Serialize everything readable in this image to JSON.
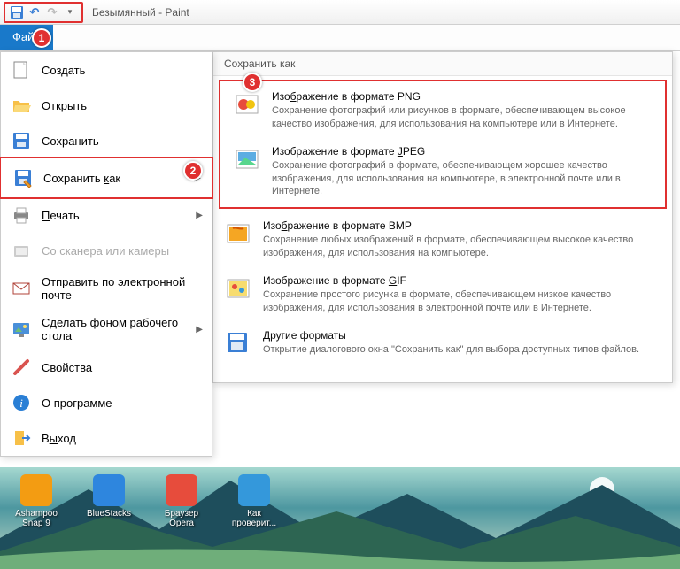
{
  "window": {
    "title": "Безымянный - Paint"
  },
  "tabs": {
    "file": "Файл"
  },
  "markers": {
    "m1": "1",
    "m2": "2",
    "m3": "3"
  },
  "file_menu": [
    {
      "label": "Создать",
      "icon": "new"
    },
    {
      "label": "Открыть",
      "icon": "open"
    },
    {
      "label": "Сохранить",
      "icon": "save"
    },
    {
      "label": "Сохранить как",
      "icon": "saveas",
      "arrow": true,
      "highlighted": true,
      "accel": "к"
    },
    {
      "label": "Печать",
      "icon": "print",
      "arrow": true,
      "accel": "П"
    },
    {
      "label": "Со сканера или камеры",
      "icon": "scanner",
      "disabled": true
    },
    {
      "label": "Отправить по электронной почте",
      "icon": "email"
    },
    {
      "label": "Сделать фоном рабочего стола",
      "icon": "wallpaper",
      "arrow": true
    },
    {
      "label": "Свойства",
      "icon": "props",
      "accel": "й"
    },
    {
      "label": "О программе",
      "icon": "about"
    },
    {
      "label": "Выход",
      "icon": "exit",
      "accel": "ы"
    }
  ],
  "submenu": {
    "header": "Сохранить как",
    "items": [
      {
        "title": "Изображение в формате PNG",
        "desc": "Сохранение фотографий или рисунков в формате, обеспечивающем высокое качество изображения, для использования на компьютере или в Интернете.",
        "icon": "png",
        "accel": "б"
      },
      {
        "title": "Изображение в формате JPEG",
        "desc": "Сохранение фотографий в формате, обеспечивающем хорошее качество изображения, для использования на компьютере, в электронной почте или в Интернете.",
        "icon": "jpeg",
        "accel": "J"
      },
      {
        "title": "Изображение в формате BMP",
        "desc": "Сохранение любых изображений в формате, обеспечивающем высокое качество изображения, для использования на компьютере.",
        "icon": "bmp",
        "accel": "б"
      },
      {
        "title": "Изображение в формате GIF",
        "desc": "Сохранение простого рисунка в формате, обеспечивающем низкое качество изображения, для использования в электронной почте или в Интернете.",
        "icon": "gif",
        "accel": "G"
      },
      {
        "title": "Другие форматы",
        "desc": "Открытие диалогового окна \"Сохранить как\" для выбора доступных типов файлов.",
        "icon": "other",
        "accel": "Д"
      }
    ]
  },
  "desktop_icons": [
    {
      "label": "Ashampoo Snap 9",
      "color": "#f39c12"
    },
    {
      "label": "BlueStacks",
      "color": "#2e86de"
    },
    {
      "label": "Браузер Opera",
      "color": "#e74c3c"
    },
    {
      "label": "Как проверит...",
      "color": "#3498db"
    }
  ]
}
